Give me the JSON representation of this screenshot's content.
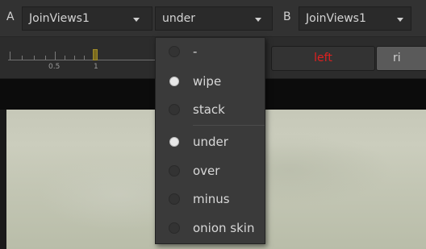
{
  "top_bar": {
    "input_a": {
      "label": "A",
      "value": "JoinViews1"
    },
    "wipe_mode": {
      "value": "under"
    },
    "input_b": {
      "label": "B",
      "value": "JoinViews1"
    }
  },
  "toolbar": {
    "scale_labels": [
      "0.5",
      "1"
    ],
    "scale_value": 1,
    "view_buttons": [
      {
        "label": "left",
        "color": "#e02020"
      },
      {
        "label": "ri",
        "color": "#cfcfcf"
      }
    ]
  },
  "wipe_menu": {
    "items": [
      {
        "label": "-",
        "selected": false
      },
      {
        "label": "wipe",
        "selected": true
      },
      {
        "label": "stack",
        "selected": false
      },
      {
        "label": "under",
        "selected": true
      },
      {
        "label": "over",
        "selected": false
      },
      {
        "label": "minus",
        "selected": false
      },
      {
        "label": "onion skin",
        "selected": false
      }
    ]
  },
  "icons": {
    "dropdown_caret": "chevron-down-icon",
    "radio": "radio-button-icon"
  },
  "colors": {
    "accent_red": "#e02020",
    "scale_handle": "#7a6a1e"
  }
}
